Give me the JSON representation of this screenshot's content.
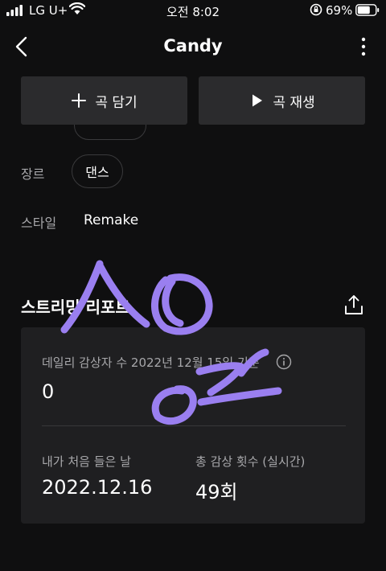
{
  "status_bar": {
    "carrier": "LG U+",
    "time": "오전 8:02",
    "battery": "69%"
  },
  "header": {
    "title": "Candy",
    "back_icon": "chevron-left-icon",
    "more_icon": "more-vertical-icon"
  },
  "actions": {
    "add_label": "곡 담기",
    "play_label": "곡 재생"
  },
  "meta": {
    "genre_label": "장르",
    "genre_value": "댄스",
    "style_label": "스타일",
    "style_value": "Remake"
  },
  "report": {
    "title": "스트리밍 리포트",
    "daily_label": "데일리 감상자 수 2022년 12월 15일 기준",
    "daily_value": "0",
    "first_listen_label": "내가 처음 들은 날",
    "first_listen_value": "2022.12.16",
    "total_plays_label": "총 감상 횟수 (실시간)",
    "total_plays_value": "49회"
  },
  "overlay": {
    "handwriting_color": "#9a7ff0"
  }
}
